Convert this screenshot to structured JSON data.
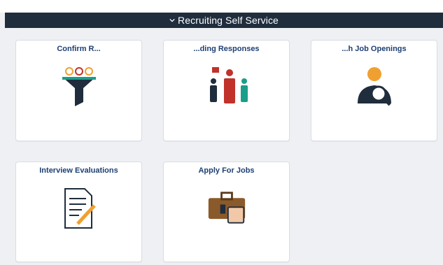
{
  "header": {
    "title": "Recruiting Self Service"
  },
  "tiles": [
    {
      "label": "Confirm R...",
      "icon": "funnel-icon"
    },
    {
      "label": "...ding Responses",
      "icon": "people-icon"
    },
    {
      "label": "...h Job Openings",
      "icon": "magnifier-person-icon"
    },
    {
      "label": "Interview Evaluations",
      "icon": "evaluation-form-icon"
    },
    {
      "label": "Apply For Jobs",
      "icon": "briefcase-icon"
    }
  ],
  "colors": {
    "header_bg": "#1f2d3d",
    "tile_label": "#1d3f73",
    "accent_red": "#c0322a",
    "accent_teal": "#1a9e8a",
    "accent_orange": "#f0a030"
  }
}
